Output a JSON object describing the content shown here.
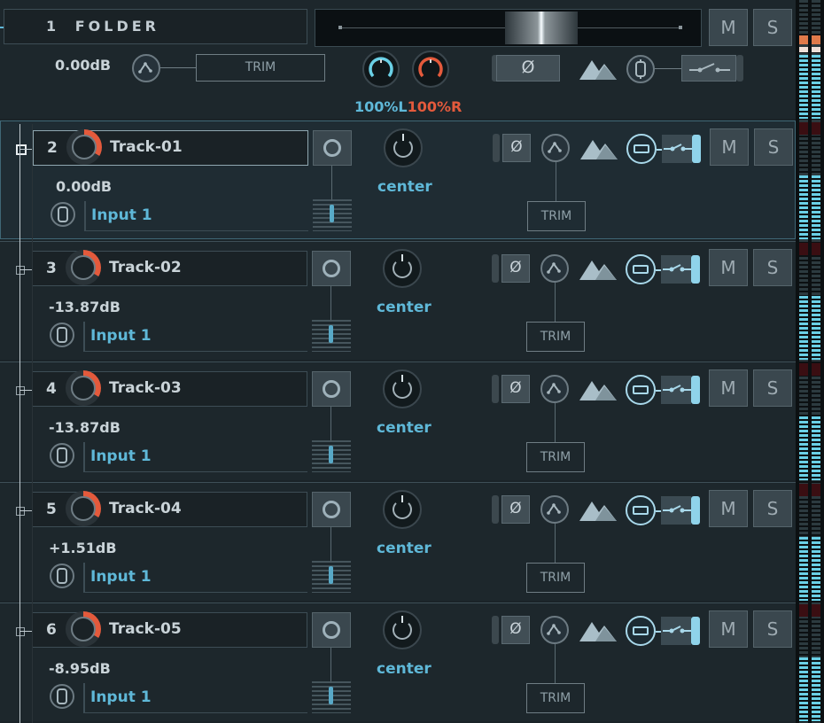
{
  "folder": {
    "number": "1",
    "name": "FOLDER",
    "gain": "0.00dB",
    "trim_label": "TRIM",
    "pan_left": "100%L",
    "pan_right": "100%R",
    "phase_symbol": "Ø",
    "mute_label": "M",
    "solo_label": "S"
  },
  "tracks": [
    {
      "number": "2",
      "name": "Track-01",
      "gain": "0.00dB",
      "input": "Input 1",
      "pan": "center",
      "trim": "TRIM",
      "phase": "Ø",
      "mute": "M",
      "solo": "S",
      "selected": true
    },
    {
      "number": "3",
      "name": "Track-02",
      "gain": "-13.87dB",
      "input": "Input 1",
      "pan": "center",
      "trim": "TRIM",
      "phase": "Ø",
      "mute": "M",
      "solo": "S",
      "selected": false
    },
    {
      "number": "4",
      "name": "Track-03",
      "gain": "-13.87dB",
      "input": "Input 1",
      "pan": "center",
      "trim": "TRIM",
      "phase": "Ø",
      "mute": "M",
      "solo": "S",
      "selected": false
    },
    {
      "number": "5",
      "name": "Track-04",
      "gain": "+1.51dB",
      "input": "Input 1",
      "pan": "center",
      "trim": "TRIM",
      "phase": "Ø",
      "mute": "M",
      "solo": "S",
      "selected": false
    },
    {
      "number": "6",
      "name": "Track-05",
      "gain": "-8.95dB",
      "input": "Input 1",
      "pan": "center",
      "trim": "TRIM",
      "phase": "Ø",
      "mute": "M",
      "solo": "S",
      "selected": false
    }
  ],
  "colors": {
    "accent_blue": "#5fb8d8",
    "accent_red": "#e45a3c",
    "panel_bg": "#1d272c",
    "meter_cyan": "#6ad0e6"
  }
}
